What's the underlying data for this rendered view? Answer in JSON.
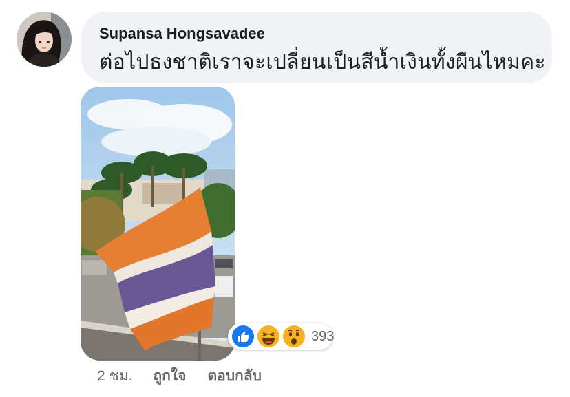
{
  "comment": {
    "author": "Supansa Hongsavadee",
    "text": "ต่อไปธงชาติเราจะเปลี่ยนเป็นสีน้ำเงินทั้งผืนไหมคะ",
    "reaction_count": "393",
    "reaction_icons": [
      "like-icon",
      "haha-icon",
      "wow-icon"
    ],
    "timestamp": "2 ชม.",
    "like_label": "ถูกใจ",
    "reply_label": "ตอบกลับ"
  },
  "colors": {
    "bubble": "#f0f2f5",
    "like_blue": "#1877f2",
    "reaction_yellow": "#f7b125",
    "meta_gray": "#65676b"
  }
}
